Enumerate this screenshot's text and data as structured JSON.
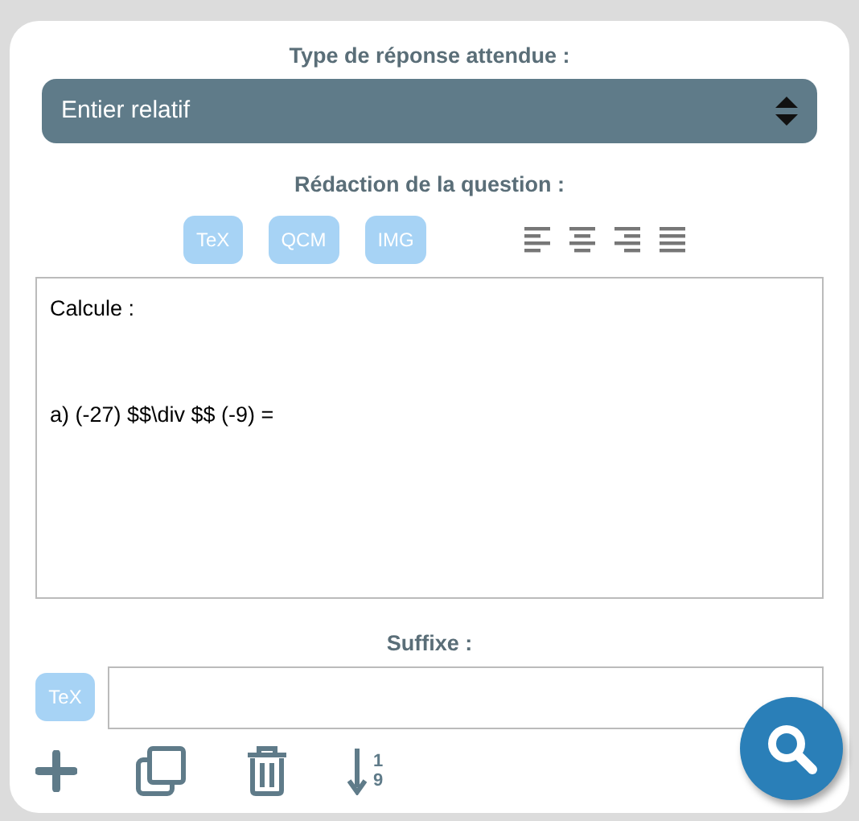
{
  "response_type": {
    "label": "Type de réponse attendue :",
    "value": "Entier relatif"
  },
  "question": {
    "label": "Rédaction de la question :",
    "insert_buttons": [
      "TeX",
      "QCM",
      "IMG"
    ],
    "align_buttons": [
      {
        "kind": "left",
        "selected": false
      },
      {
        "kind": "center",
        "selected": false
      },
      {
        "kind": "right",
        "selected": false
      },
      {
        "kind": "justify",
        "selected": false
      }
    ],
    "text": "Calcule :\n\n\na) (-27) $$\\div $$ (-9) ="
  },
  "suffix": {
    "label": "Suffixe :",
    "button": "TeX"
  },
  "toolbar": [
    {
      "kind": "add"
    },
    {
      "kind": "duplicate"
    },
    {
      "kind": "delete"
    },
    {
      "kind": "sort",
      "digits": [
        "1",
        "9"
      ]
    }
  ]
}
